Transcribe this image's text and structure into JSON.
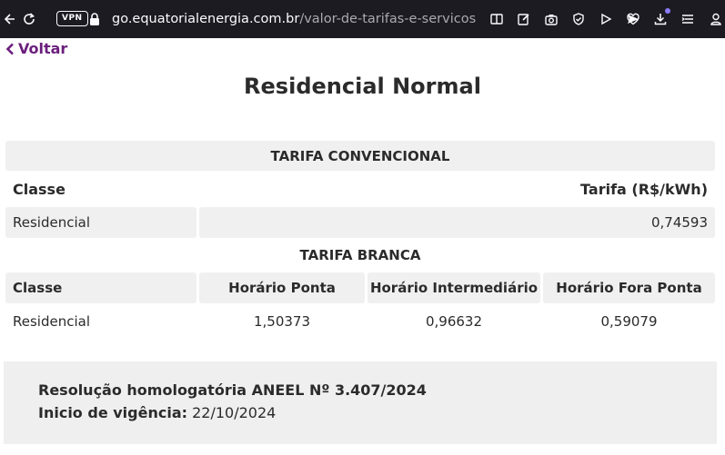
{
  "browser": {
    "vpn_label": "VPN",
    "url_host": "go.equatorialenergia.com.br",
    "url_path": "/valor-de-tarifas-e-servicos/#reside"
  },
  "page": {
    "back_label": "Voltar",
    "title": "Residencial Normal"
  },
  "tarifa_convencional": {
    "heading": "TARIFA CONVENCIONAL",
    "columns": [
      "Classe",
      "Tarifa (R$/kWh)"
    ],
    "rows": [
      [
        "Residencial",
        "0,74593"
      ]
    ]
  },
  "tarifa_branca": {
    "heading": "TARIFA BRANCA",
    "columns": [
      "Classe",
      "Horário Ponta",
      "Horário Intermediário",
      "Horário Fora Ponta"
    ],
    "rows": [
      [
        "Residencial",
        "1,50373",
        "0,96632",
        "0,59079"
      ]
    ]
  },
  "footer": {
    "resolution": "Resolução homologatória ANEEL Nº 3.407/2024",
    "start_label": "Inicio de vigência:",
    "start_value": "22/10/2024"
  },
  "colors": {
    "toolbar_bg": "#1c1b22",
    "accent": "#6b1f7c",
    "cell_bg": "#f0f0f0"
  }
}
